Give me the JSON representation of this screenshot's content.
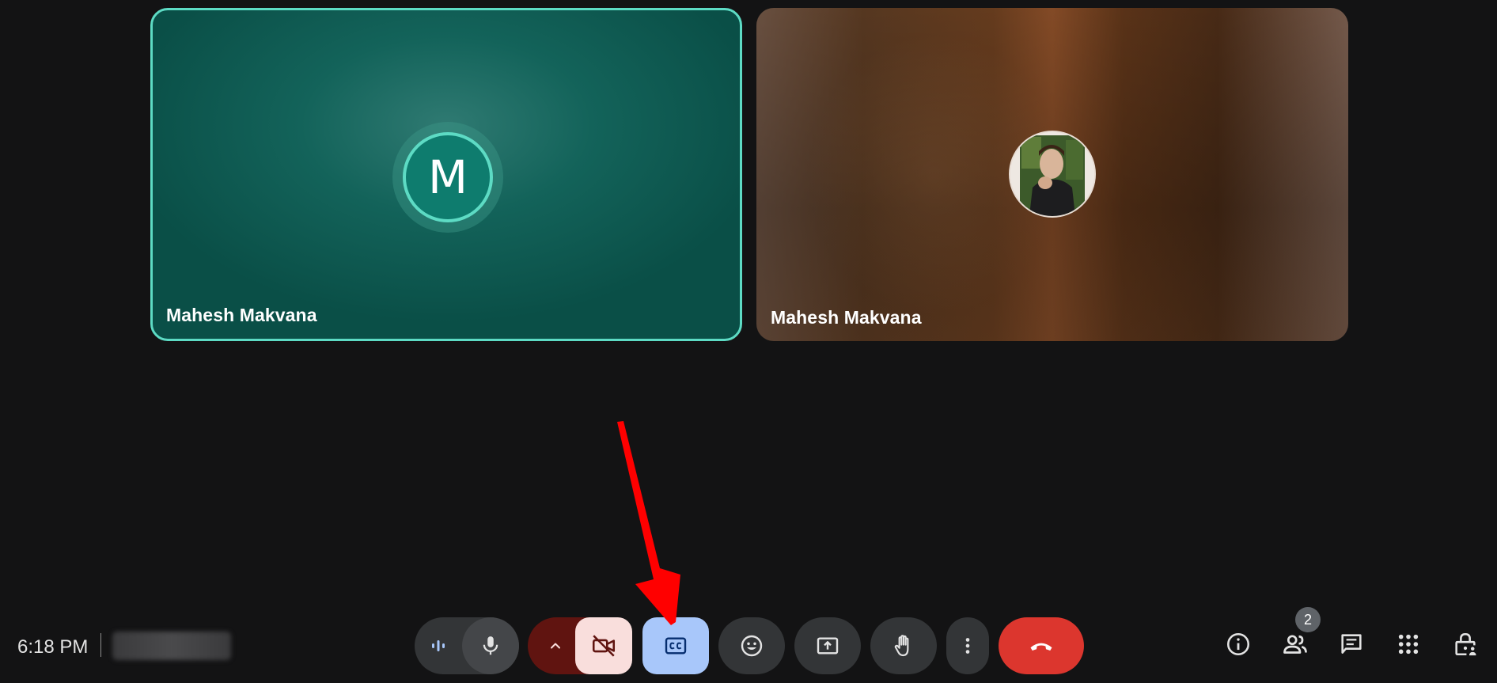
{
  "tiles": [
    {
      "name": "Mahesh Makvana",
      "avatar_letter": "M",
      "speaking": true
    },
    {
      "name": "Mahesh Makvana",
      "avatar_type": "photo"
    }
  ],
  "bottom_bar": {
    "time": "6:18 PM",
    "participants_count": "2"
  },
  "icons": {
    "audio_level": "audio-level-icon",
    "mic": "microphone-icon",
    "cam_options": "chevron-up-icon",
    "camera": "camera-off-icon",
    "captions": "closed-captions-icon",
    "reactions": "emoji-icon",
    "present": "present-screen-icon",
    "raise_hand": "raise-hand-icon",
    "more": "more-options-icon",
    "leave": "end-call-icon",
    "info": "info-icon",
    "people": "people-icon",
    "chat": "chat-icon",
    "activities": "apps-grid-icon",
    "host_controls": "lock-person-icon"
  },
  "colors": {
    "background": "#131314",
    "speaking_border": "#5ddbc4",
    "captions_active": "#a8c7fa",
    "camera_off": "#f9dedc",
    "leave": "#dc362e",
    "annotation_arrow": "#ff0000"
  }
}
